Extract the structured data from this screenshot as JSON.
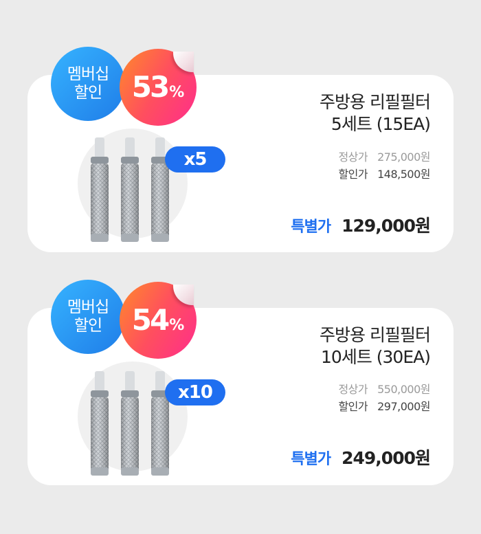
{
  "products": [
    {
      "member_line1": "멤버십",
      "member_line2": "할인",
      "discount_number": "53",
      "discount_percent": "%",
      "quantity": "x5",
      "title_line1": "주방용 리필필터",
      "title_line2": "5세트 (15EA)",
      "regular_label": "정상가",
      "regular_price": "275,000원",
      "discount_label": "할인가",
      "discount_price": "148,500원",
      "special_label": "특별가",
      "special_price": "129,000원"
    },
    {
      "member_line1": "멤버십",
      "member_line2": "할인",
      "discount_number": "54",
      "discount_percent": "%",
      "quantity": "x10",
      "title_line1": "주방용 리필필터",
      "title_line2": "10세트 (30EA)",
      "regular_label": "정상가",
      "regular_price": "550,000원",
      "discount_label": "할인가",
      "discount_price": "297,000원",
      "special_label": "특별가",
      "special_price": "249,000원"
    }
  ],
  "colors": {
    "background": "#ebebeb",
    "member_badge": "#1f7de8",
    "discount_badge": "#ff4f5e",
    "quantity_badge": "#1f6ff0",
    "special_label": "#1f6ff0"
  }
}
